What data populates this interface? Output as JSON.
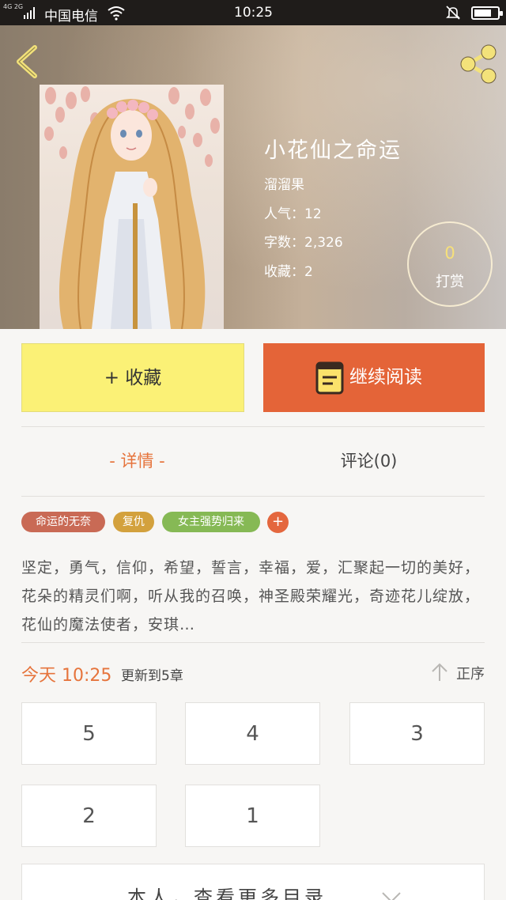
{
  "status_bar": {
    "network": "4G 2G",
    "carrier": "中国电信",
    "time": "10:25",
    "battery_level": 0.75
  },
  "book": {
    "title": "小花仙之命运",
    "author": "溜溜果",
    "popularity": "人气：12",
    "word_count": "字数：2,326",
    "favorites": "收藏：2",
    "reward_count": "0",
    "reward_label": "打赏"
  },
  "actions": {
    "collect_label": "+ 收藏",
    "read_label": "继续阅读"
  },
  "tabs": {
    "details": "- 详情 -",
    "comments": "评论(0)"
  },
  "tags": [
    "命运的无奈",
    "复仇",
    "女主强势归来"
  ],
  "tag_add": "+",
  "description": "坚定，勇气，信仰，希望，誓言，幸福，爱，汇聚起一切的美好，花朵的精灵们啊，听从我的召唤，神圣殿荣耀光，奇迹花儿绽放，花仙的魔法使者，安琪…",
  "update": {
    "today": "今天 10:25",
    "text": "更新到5章",
    "sort": "正序"
  },
  "chapters": [
    "5",
    "4",
    "3",
    "2",
    "1"
  ],
  "more_label": "本人，查看更多目录",
  "colors": {
    "accent": "#e46438",
    "collect_button": "#fbf176",
    "tag_1": "#c96a55",
    "tag_2": "#d3a13d",
    "tag_3": "#86b955"
  }
}
